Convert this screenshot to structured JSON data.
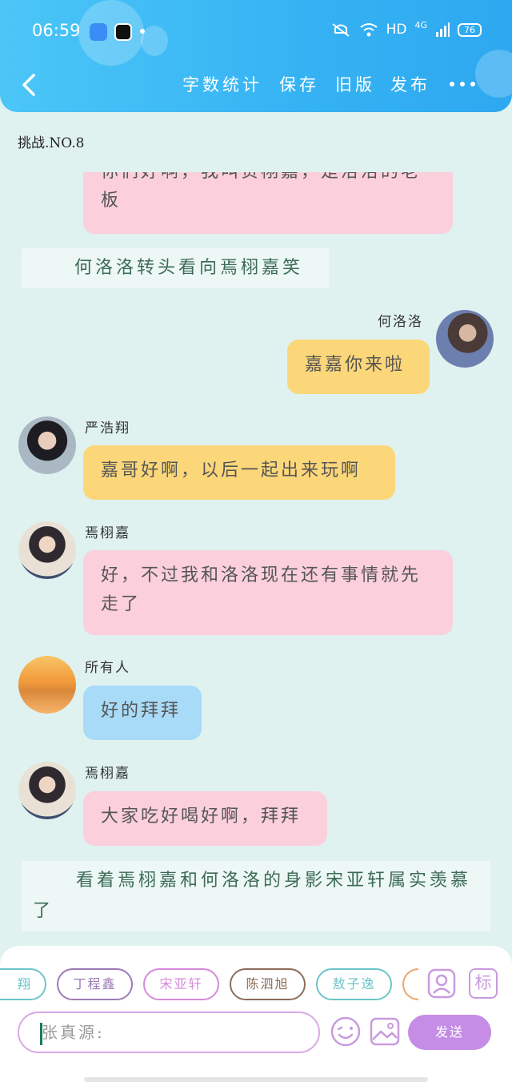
{
  "status_bar": {
    "time": "06:59",
    "network": "HD",
    "signal": "4G",
    "battery": "76"
  },
  "toolbar": {
    "word_count": "字数统计",
    "save": "保存",
    "old_version": "旧版",
    "publish": "发布"
  },
  "chapter_title": "挑战.NO.8",
  "messages": {
    "m0_text": "你们好啊，我叫贺栩嘉，是洛洛的老板",
    "m0_line2": "的老板",
    "narr1": "何洛洛转头看向焉栩嘉笑",
    "m1_name": "何洛洛",
    "m1_text": "嘉嘉你来啦",
    "m2_name": "严浩翔",
    "m2_text": "嘉哥好啊，以后一起出来玩啊",
    "m3_name": "焉栩嘉",
    "m3_text": "好，不过我和洛洛现在还有事情就先走了",
    "m4_name": "所有人",
    "m4_text": "好的拜拜",
    "m5_name": "焉栩嘉",
    "m5_text": "大家吃好喝好啊，拜拜",
    "narr2": "看着焉栩嘉和何洛洛的身影宋亚轩属实羡慕了"
  },
  "bottom_panel": {
    "chips": [
      "翔",
      "丁程鑫",
      "宋亚轩",
      "陈泗旭",
      "敖子逸"
    ],
    "tag_button": "标",
    "input_placeholder": "张真源:",
    "send_label": "发送"
  },
  "colors": {
    "header": "#35b2f3",
    "pink_bubble": "#fbcfdc",
    "yellow_bubble": "#fbd77a",
    "blue_bubble": "#a8dbf7",
    "send": "#c58de6"
  }
}
